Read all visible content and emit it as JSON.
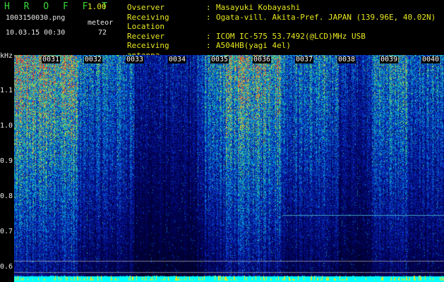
{
  "header": {
    "app_title": "H R O F F T",
    "version": "1.00",
    "filename": "1003150030.png",
    "meteor_label": "meteor",
    "meteor_count": "72",
    "datetime": "10.03.15 00:30"
  },
  "station_info": [
    {
      "key": "Ovserver",
      "sep": ":",
      "value": "Masayuki Kobayashi"
    },
    {
      "key": "Receiving Location",
      "sep": ":",
      "value": "Ogata-vill. Akita-Pref. JAPAN (139.96E, 40.02N)"
    },
    {
      "key": "Receiver",
      "sep": ":",
      "value": "ICOM IC-575 53.7492(@LCD)MHz USB"
    },
    {
      "key": "Receiving antenna",
      "sep": ":",
      "value": "A504HB(yagi 4el)"
    }
  ],
  "y_axis": {
    "unit": "kHz",
    "ticks": [
      "1.1",
      "1.0",
      "0.9",
      "0.8",
      "0.7",
      "0.6"
    ]
  },
  "x_axis": {
    "ticks": [
      "0031",
      "0032",
      "0033",
      "0034",
      "0035",
      "0036",
      "0037",
      "0038",
      "0039",
      "0040"
    ]
  },
  "colors": {
    "background": "#000000",
    "title_green": "#38d838",
    "info_yellow": "#e8e820",
    "label_white": "#e8e8e8",
    "noise_floor": "#00ffff"
  }
}
